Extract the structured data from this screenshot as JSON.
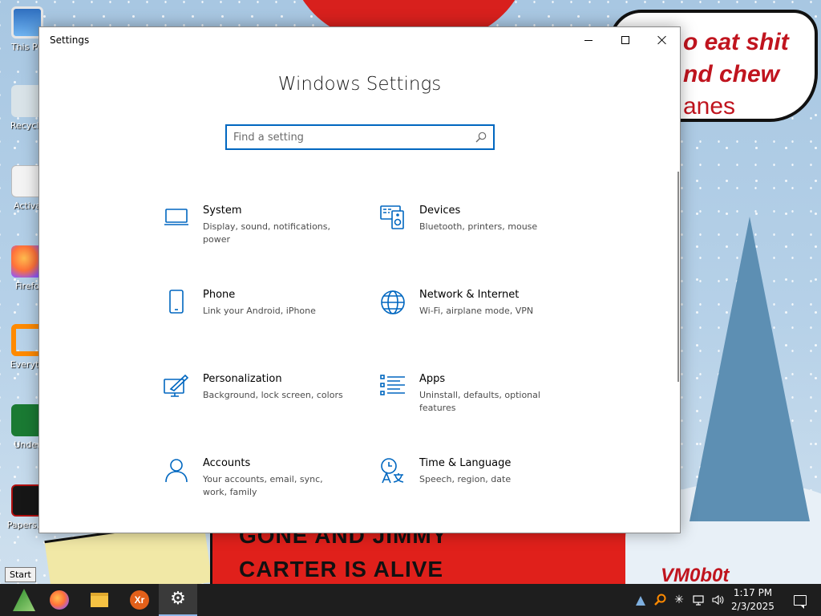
{
  "wallpaper": {
    "bubble_lines": [
      "o eat shit",
      "nd chew",
      "anes"
    ],
    "shirt_lines": [
      "GONE AND JIMMY",
      "CARTER IS ALIVE"
    ],
    "signature": "VM0b0t"
  },
  "desktop_icons": [
    {
      "label": "This PC",
      "icon": "this-pc-icon"
    },
    {
      "label": "Recycle",
      "icon": "recycle-bin-icon"
    },
    {
      "label": "Activa",
      "icon": "activate-icon"
    },
    {
      "label": "Firefo",
      "icon": "firefox-icon"
    },
    {
      "label": "Everyth",
      "icon": "everything-icon"
    },
    {
      "label": "Under",
      "icon": "undertale-icon"
    },
    {
      "label": "Papers, P",
      "icon": "papers-please-icon"
    }
  ],
  "window": {
    "title": "Settings",
    "page_title": "Windows Settings",
    "search_placeholder": "Find a setting"
  },
  "categories": [
    {
      "name": "System",
      "description": "Display, sound, notifications, power",
      "icon": "laptop-icon"
    },
    {
      "name": "Devices",
      "description": "Bluetooth, printers, mouse",
      "icon": "devices-icon"
    },
    {
      "name": "Phone",
      "description": "Link your Android, iPhone",
      "icon": "phone-icon"
    },
    {
      "name": "Network & Internet",
      "description": "Wi-Fi, airplane mode, VPN",
      "icon": "globe-icon"
    },
    {
      "name": "Personalization",
      "description": "Background, lock screen, colors",
      "icon": "personalization-icon"
    },
    {
      "name": "Apps",
      "description": "Uninstall, defaults, optional features",
      "icon": "apps-list-icon"
    },
    {
      "name": "Accounts",
      "description": "Your accounts, email, sync, work, family",
      "icon": "person-icon"
    },
    {
      "name": "Time & Language",
      "description": "Speech, region, date",
      "icon": "time-language-icon"
    }
  ],
  "taskbar": {
    "start_tooltip": "Start",
    "items": [
      "Start",
      "Firefox",
      "File Explorer",
      "Xr",
      "Settings"
    ],
    "xr_glyph": "Xr",
    "gear_glyph": "⚙",
    "time": "1:17 PM",
    "date": "2/3/2025",
    "tray_glyphs": {
      "fan": "✳",
      "volume": "🔊"
    }
  },
  "colors": {
    "accent": "#0067c0",
    "taskbar": "#1e1e1e",
    "window_bg": "#ffffff"
  }
}
